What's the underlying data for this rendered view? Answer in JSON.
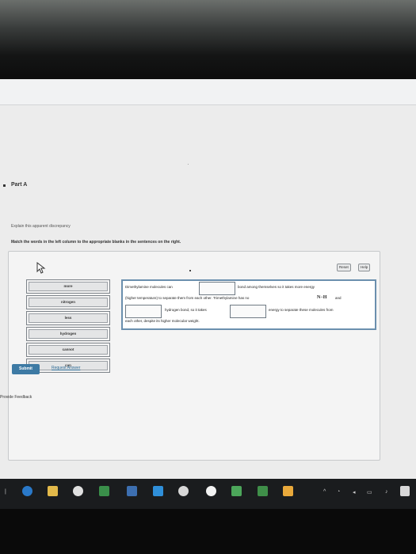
{
  "part": {
    "title": "Part A"
  },
  "instructions": {
    "line1": "Explain this apparent discrepancy",
    "line2": "Match the words in the left column to the appropriate blanks in the sentences on the right."
  },
  "controls": {
    "reset_label": "Reset",
    "help_label": "Help"
  },
  "word_bank": [
    {
      "label": "more"
    },
    {
      "label": "nitrogen"
    },
    {
      "label": "less"
    },
    {
      "label": "hydrogen"
    },
    {
      "label": "cannot"
    },
    {
      "label": "can"
    }
  ],
  "sentence": {
    "s1": "Dimethylamine molecules can",
    "s2": "bond among themselves so it takes more energy",
    "s3": "(higher temperature) to separate them from each other. Trimethylamine has no",
    "formula": "N−H",
    "s4": "and",
    "s5": "hydrogen bond, so it takes",
    "s6": "energy to separate these molecules from",
    "s7": "each other, despite its higher molecular weight."
  },
  "actions": {
    "submit_label": "Submit",
    "request_answer_label": "Request Answer"
  },
  "footer": {
    "feedback_label": "Provide Feedback"
  },
  "colors": {
    "submit_bg": "#3d7aa4",
    "link": "#2b6a95",
    "sentence_border": "#6b8fae"
  }
}
